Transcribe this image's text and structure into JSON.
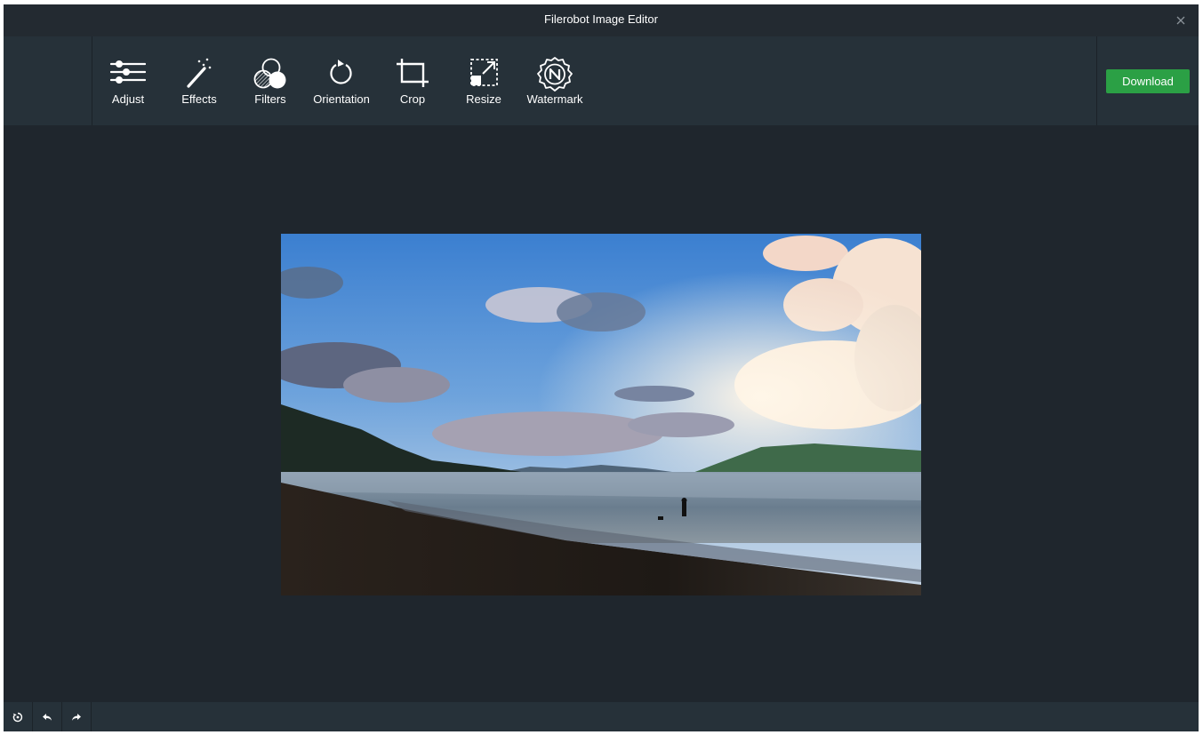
{
  "window": {
    "title": "Filerobot Image Editor",
    "close_icon": "close-icon"
  },
  "toolbar": {
    "tools": [
      {
        "label": "Adjust",
        "icon": "sliders-icon"
      },
      {
        "label": "Effects",
        "icon": "magic-wand-icon"
      },
      {
        "label": "Filters",
        "icon": "filters-icon"
      },
      {
        "label": "Orientation",
        "icon": "rotate-icon"
      },
      {
        "label": "Crop",
        "icon": "crop-icon"
      },
      {
        "label": "Resize",
        "icon": "resize-icon"
      },
      {
        "label": "Watermark",
        "icon": "watermark-icon"
      }
    ],
    "download_label": "Download"
  },
  "footer": {
    "buttons": [
      {
        "icon": "reset-icon"
      },
      {
        "icon": "undo-icon"
      },
      {
        "icon": "redo-icon"
      }
    ]
  },
  "colors": {
    "window_bg": "#1f262d",
    "toolbar_bg": "#263139",
    "accent_green": "#2ba045",
    "text": "#ffffff"
  }
}
